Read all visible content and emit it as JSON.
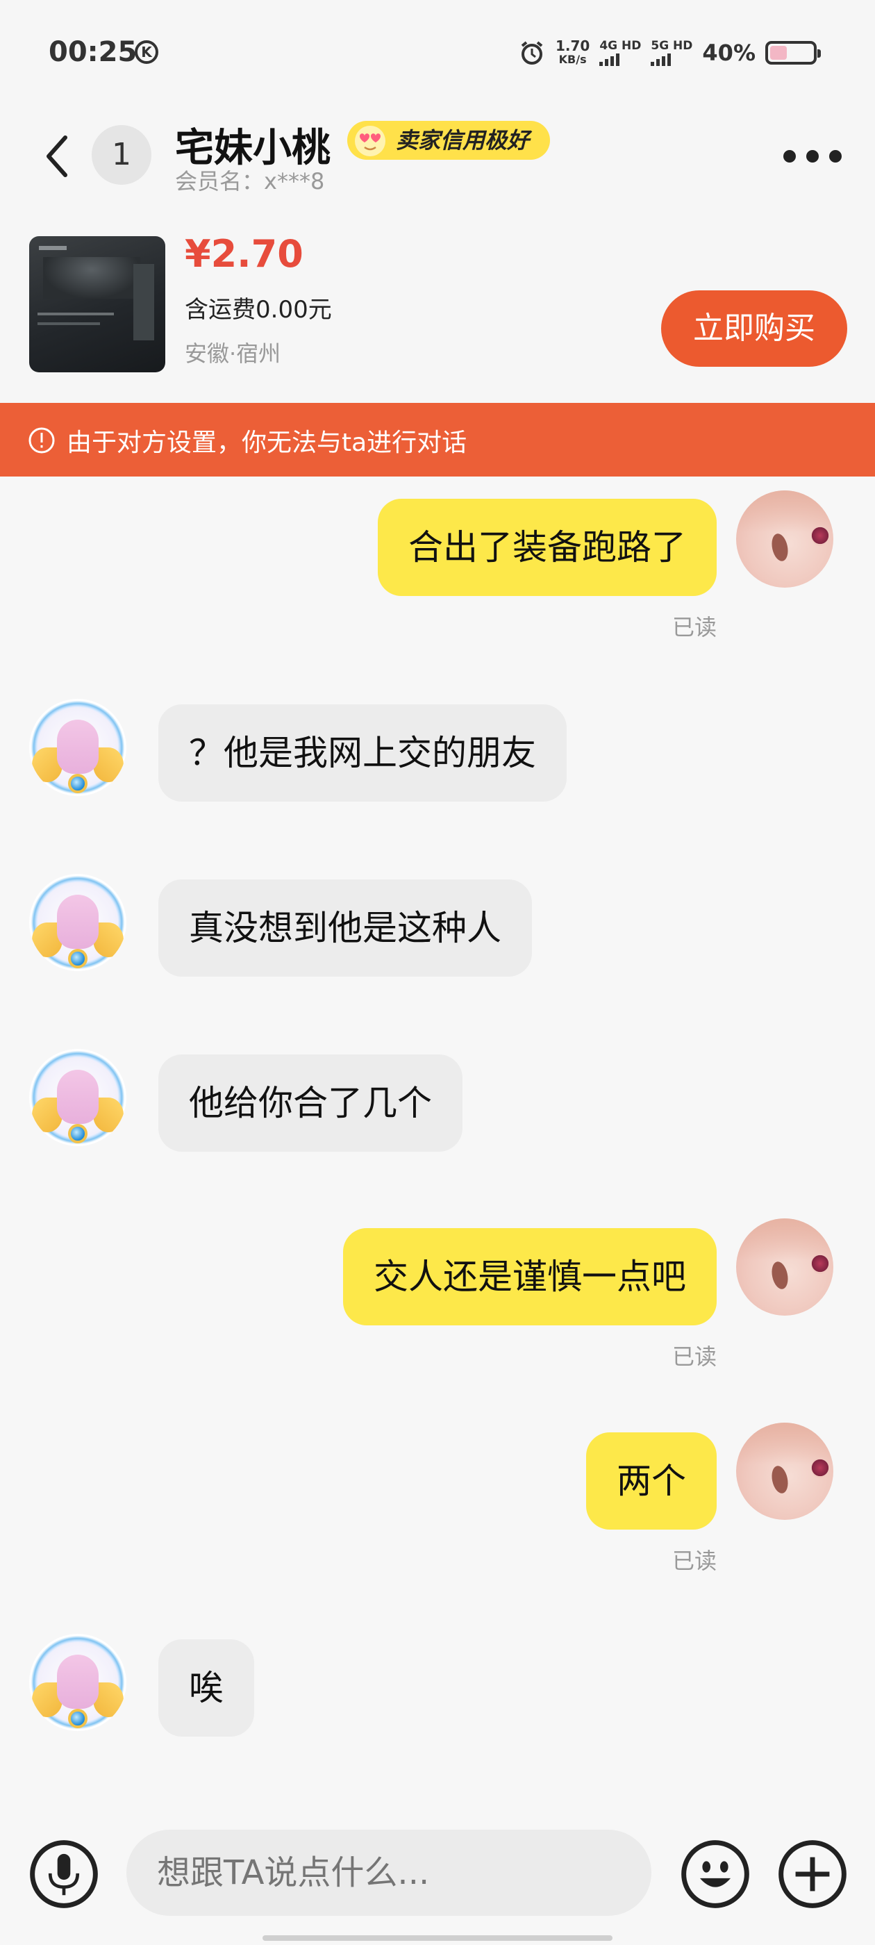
{
  "status_bar": {
    "time": "00:25",
    "k_icon": "K",
    "speed_value": "1.70",
    "speed_unit": "KB/s",
    "net1": "4G HD",
    "net2": "5G HD",
    "battery": "40%",
    "battery_level": 0.4,
    "battery_color": "#f3b7c5"
  },
  "header": {
    "unread_count": "1",
    "name": "宅妹小桃",
    "credit_badge": "卖家信用极好",
    "member_name": "会员名：x***8"
  },
  "product": {
    "price": "¥2.70",
    "shipping": "含运费0.00元",
    "location": "安徽·宿州",
    "buy_label": "立即购买"
  },
  "notice": {
    "text": "由于对方设置，你无法与ta进行对话"
  },
  "messages": [
    {
      "from": "me",
      "text": "合出了装备跑路了",
      "status": "已读"
    },
    {
      "from": "other",
      "text": "？他是我网上交的朋友"
    },
    {
      "from": "other",
      "text": "真没想到他是这种人"
    },
    {
      "from": "other",
      "text": "他给你合了几个"
    },
    {
      "from": "me",
      "text": "交人还是谨慎一点吧",
      "status": "已读"
    },
    {
      "from": "me",
      "text": "两个",
      "status": "已读"
    },
    {
      "from": "other",
      "text": "唉"
    }
  ],
  "input": {
    "placeholder": "想跟TA说点什么..."
  },
  "colors": {
    "accent": "#ec5a2f",
    "price": "#e74c3c",
    "bubble_me": "#fde84a",
    "bubble_other": "#ececec",
    "badge": "#ffe14a"
  },
  "icons": {
    "back": "chevron-left-icon",
    "more": "more-dots-icon",
    "notice": "alert-circle-icon",
    "mic": "microphone-icon",
    "emoji": "emoji-icon",
    "plus": "plus-icon"
  }
}
